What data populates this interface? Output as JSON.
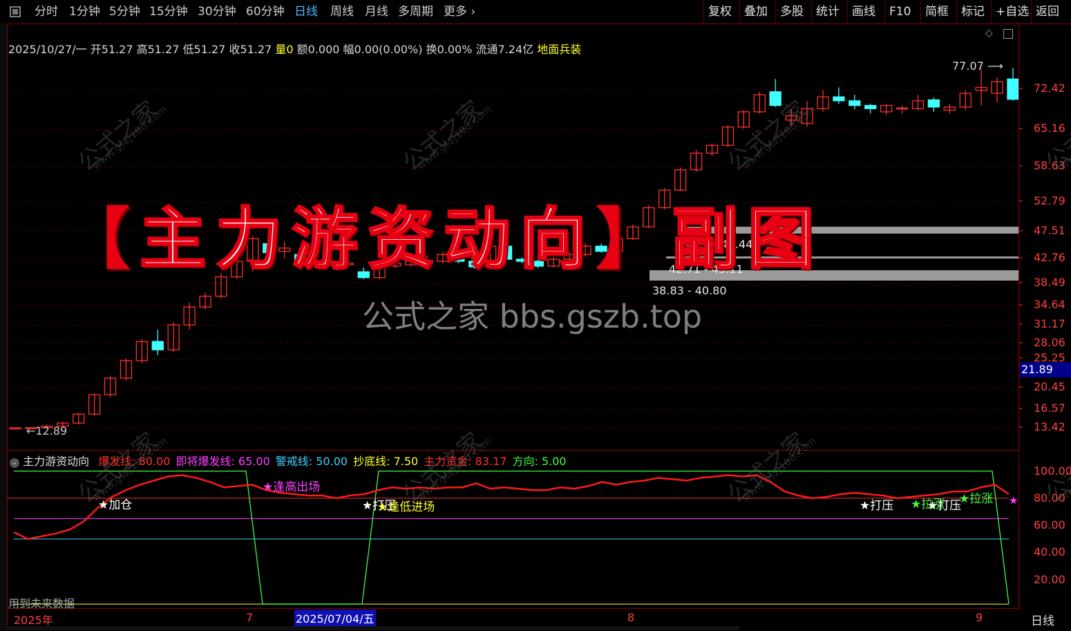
{
  "toolbar": {
    "left_items": [
      "分时",
      "1分钟",
      "5分钟",
      "15分钟",
      "30分钟",
      "60分钟",
      "日线",
      "周线",
      "月线",
      "多周期",
      "更多"
    ],
    "active": "日线",
    "right_items": [
      "复权",
      "叠加",
      "多股",
      "统计",
      "画线",
      "F10",
      "简框",
      "标记",
      "+自选",
      "返回"
    ]
  },
  "info": {
    "date": "2025/10/27/一",
    "open": "开51.27",
    "high": "高51.27",
    "low": "低51.27",
    "close": "收51.27",
    "vol_label": "量",
    "vol_value": "0",
    "amount": "额0.000",
    "change": "幅0.00(0.00%)",
    "turnover": "换0.00%",
    "float": "流通7.24亿",
    "sector": "地面兵装"
  },
  "price_axis": [
    "72.42",
    "65.16",
    "58.63",
    "52.79",
    "47.51",
    "42.76",
    "38.49",
    "34.64",
    "31.17",
    "28.06",
    "25.25",
    "20.45",
    "16.57",
    "13.42"
  ],
  "current_price": "21.89",
  "price_annotations": {
    "high_mark": "77.07",
    "low_mark": "12.89",
    "zones": [
      "46.6 - 47.44",
      "42.71 - 43.11",
      "38.83 - 40.80"
    ]
  },
  "overlay": {
    "bracket_open": "【",
    "title": "主力游资动向",
    "bracket_close": "】",
    "subtitle": "副图",
    "watermark": "公式之家 bbs.gszb.top",
    "diag_text": "公式之家",
    "diag_url": "www.gszj100.com"
  },
  "indicator": {
    "name": "主力游资动向",
    "params": [
      {
        "label": "爆发线: 80.00",
        "color": "#ff3030"
      },
      {
        "label": "即将爆发线: 65.00",
        "color": "#ff40ff"
      },
      {
        "label": "警戒线: 50.00",
        "color": "#40d0ff"
      },
      {
        "label": "抄底线: 7.50",
        "color": "#ffff30"
      },
      {
        "label": "主力资金: 83.17",
        "color": "#ff3030"
      },
      {
        "label": "方向: 5.00",
        "color": "#40ff40"
      }
    ],
    "axis": [
      "100.00",
      "80.00",
      "60.00",
      "40.00",
      "20.00"
    ],
    "signals": [
      {
        "text": "加仓",
        "color": "#ffffff"
      },
      {
        "text": "逢高出场",
        "color": "#ff40ff"
      },
      {
        "text": "打压",
        "color": "#ffffff"
      },
      {
        "text": "逢低进场",
        "color": "#ffff30"
      },
      {
        "text": "打压",
        "color": "#ffffff"
      },
      {
        "text": "拉涨",
        "color": "#40ff40"
      },
      {
        "text": "打压",
        "color": "#ffffff"
      },
      {
        "text": "拉涨",
        "color": "#40ff40"
      }
    ],
    "future_note": "用到未来数据"
  },
  "date_axis": {
    "year": "2025年",
    "m7": "7",
    "selected": "2025/07/04/五",
    "m8": "8",
    "m9": "9",
    "period": "日线"
  },
  "chart_data": {
    "type": "candlestick",
    "ylim": [
      12,
      80
    ],
    "candles": [
      [
        12.89,
        12.89,
        12.9,
        12.88
      ],
      [
        12.89,
        12.9,
        12.95,
        12.85
      ],
      [
        12.9,
        13.0,
        13.1,
        12.85
      ],
      [
        13.0,
        13.2,
        13.3,
        12.9
      ],
      [
        13.2,
        13.8,
        13.9,
        13.1
      ],
      [
        13.8,
        15.2,
        15.3,
        13.7
      ],
      [
        15.2,
        16.5,
        16.7,
        15.0
      ],
      [
        16.5,
        18.0,
        18.2,
        16.3
      ],
      [
        18.0,
        19.8,
        20.0,
        17.8
      ],
      [
        19.8,
        19.0,
        21.0,
        18.5
      ],
      [
        19.0,
        21.5,
        21.8,
        18.8
      ],
      [
        21.5,
        23.5,
        24.0,
        21.0
      ],
      [
        23.5,
        24.8,
        25.2,
        23.2
      ],
      [
        24.8,
        27.3,
        27.8,
        24.5
      ],
      [
        27.3,
        29.5,
        30.0,
        27.0
      ],
      [
        29.5,
        33.0,
        33.5,
        28.0
      ],
      [
        32.2,
        30.8,
        32.8,
        30.5
      ],
      [
        31.0,
        31.5,
        32.5,
        30.0
      ],
      [
        30.5,
        29.0,
        31.2,
        28.7
      ],
      [
        28.8,
        29.2,
        29.8,
        28.5
      ],
      [
        28.9,
        29.3,
        29.7,
        28.7
      ],
      [
        29.0,
        29.2,
        30.2,
        28.8
      ],
      [
        28.0,
        27.2,
        28.6,
        27.0
      ],
      [
        27.2,
        28.8,
        29.2,
        27.0
      ],
      [
        28.8,
        29.2,
        29.8,
        28.5
      ],
      [
        29.0,
        29.5,
        30.0,
        28.7
      ],
      [
        29.2,
        29.6,
        30.4,
        29.0
      ],
      [
        29.5,
        30.5,
        30.9,
        29.2
      ],
      [
        30.5,
        29.5,
        31.0,
        29.2
      ],
      [
        29.5,
        28.7,
        29.9,
        28.4
      ],
      [
        28.8,
        31.8,
        32.2,
        28.6
      ],
      [
        31.8,
        29.8,
        32.0,
        29.5
      ],
      [
        29.8,
        29.5,
        30.1,
        29.2
      ],
      [
        29.5,
        28.8,
        29.8,
        28.5
      ],
      [
        28.8,
        29.8,
        30.1,
        28.6
      ],
      [
        29.8,
        30.5,
        30.9,
        29.5
      ],
      [
        30.5,
        31.8,
        32.2,
        30.2
      ],
      [
        31.8,
        31.0,
        32.2,
        30.8
      ],
      [
        31.0,
        33.0,
        33.5,
        30.8
      ],
      [
        33.0,
        35.0,
        35.4,
        32.8
      ],
      [
        35.0,
        38.5,
        39.0,
        34.8
      ],
      [
        38.5,
        42.0,
        42.5,
        38.2
      ],
      [
        42.0,
        46.5,
        47.0,
        41.8
      ],
      [
        46.5,
        50.5,
        51.3,
        46.0
      ],
      [
        50.5,
        52.5,
        53.0,
        49.8
      ],
      [
        52.5,
        57.5,
        58.0,
        52.0
      ],
      [
        57.5,
        62.0,
        62.5,
        57.0
      ],
      [
        62.0,
        67.5,
        68.5,
        61.5
      ],
      [
        68.5,
        64.0,
        73.0,
        63.5
      ],
      [
        59.5,
        60.8,
        62.8,
        57.8
      ],
      [
        58.5,
        63.0,
        65.5,
        57.5
      ],
      [
        63.0,
        66.8,
        69.0,
        62.0
      ],
      [
        66.8,
        65.5,
        70.0,
        64.5
      ],
      [
        65.5,
        64.0,
        67.5,
        62.8
      ],
      [
        64.0,
        63.0,
        64.5,
        61.5
      ],
      [
        62.0,
        64.0,
        64.5,
        61.0
      ],
      [
        63.0,
        63.2,
        64.0,
        61.5
      ],
      [
        63.0,
        65.5,
        67.5,
        62.5
      ],
      [
        65.8,
        63.5,
        66.5,
        62.0
      ],
      [
        62.5,
        63.5,
        64.5,
        61.5
      ],
      [
        63.5,
        68.0,
        69.0,
        62.5
      ],
      [
        69.0,
        70.0,
        77.0,
        64.0
      ],
      [
        68.0,
        72.0,
        73.5,
        65.0
      ],
      [
        73.0,
        66.0,
        77.07,
        65.5
      ]
    ],
    "indicator_series": {
      "main_fund": [
        55,
        50,
        52,
        54,
        57,
        63,
        73,
        81,
        86,
        90,
        93,
        96,
        97,
        95,
        92,
        88,
        89,
        90,
        86,
        84,
        83,
        82,
        82,
        80,
        82,
        83,
        86,
        88,
        87,
        88,
        87,
        88,
        88,
        91,
        87,
        88,
        87,
        86,
        86,
        88,
        87,
        89,
        92,
        90,
        92,
        93,
        95,
        94,
        93,
        95,
        96,
        97,
        96,
        97,
        92,
        85,
        82,
        80,
        81,
        83,
        84,
        83,
        82,
        80,
        81,
        82,
        83,
        85,
        85,
        88,
        90,
        83
      ]
    }
  }
}
